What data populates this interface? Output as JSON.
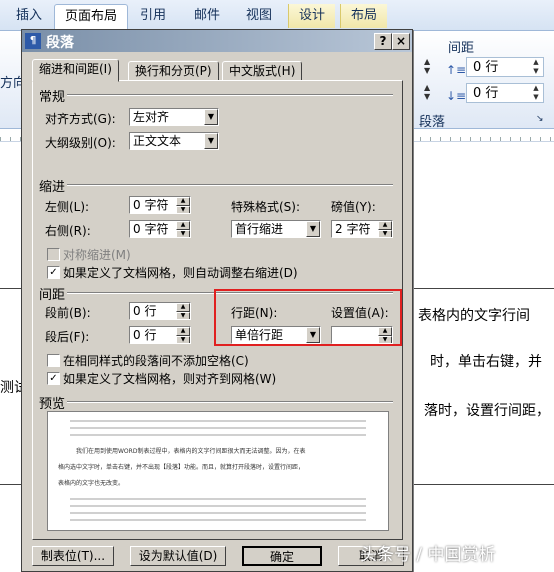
{
  "ribbon": {
    "tabs": [
      "插入",
      "页面布局",
      "引用",
      "邮件",
      "视图",
      "设计",
      "布局"
    ],
    "active_tab": "页面布局",
    "group_label_spacing": "间距",
    "group_label_paragraph": "段落",
    "spacing_before": "0 行",
    "spacing_after": "0 行",
    "left_fragment": "方向"
  },
  "document": {
    "line1": "表格内的文字行间",
    "line2": "时，单击右键，并",
    "line3": "落时，设置行间距，",
    "left_fragment": "测试"
  },
  "dialog": {
    "title": "段落",
    "help_button": "?",
    "close_button": "×",
    "tabs": [
      "缩进和间距(I)",
      "换行和分页(P)",
      "中文版式(H)"
    ],
    "general": {
      "section": "常规",
      "alignment_label": "对齐方式(G):",
      "alignment_value": "左对齐",
      "outline_label": "大纲级别(O):",
      "outline_value": "正文文本"
    },
    "indent": {
      "section": "缩进",
      "left_label": "左侧(L):",
      "left_value": "0 字符",
      "right_label": "右侧(R):",
      "right_value": "0 字符",
      "special_label": "特殊格式(S):",
      "special_value": "首行缩进",
      "by_label": "磅值(Y):",
      "by_value": "2 字符",
      "mirror_label": "对称缩进(M)",
      "auto_adjust_label": "如果定义了文档网格，则自动调整右缩进(D)"
    },
    "spacing": {
      "section": "间距",
      "before_label": "段前(B):",
      "before_value": "0 行",
      "after_label": "段后(F):",
      "after_value": "0 行",
      "line_label": "行距(N):",
      "line_value": "单倍行距",
      "at_label": "设置值(A):",
      "at_value": "",
      "no_space_label": "在相同样式的段落间不添加空格(C)",
      "snap_grid_label": "如果定义了文档网格，则对齐到网格(W)"
    },
    "preview": {
      "section": "预览",
      "sample_line1": "我们在用到使用WORD制表过程中，表格内的文字行间距很大而无法调整。因为，在表",
      "sample_line2": "格内选中文字时，单击右键，并不出现【段落】功能。而且，就算打开段落时，设置行间距，",
      "sample_line3": "表格内的文字也无改变。"
    },
    "buttons": {
      "tabs": "制表位(T)...",
      "default": "设为默认值(D)",
      "ok": "确定",
      "cancel": "取消"
    },
    "checked_mark": "✓"
  },
  "watermark": "头条号 / 中国赏析",
  "colors": {
    "highlight": "#e02020",
    "dialog_bg": "#d4d0c8"
  }
}
